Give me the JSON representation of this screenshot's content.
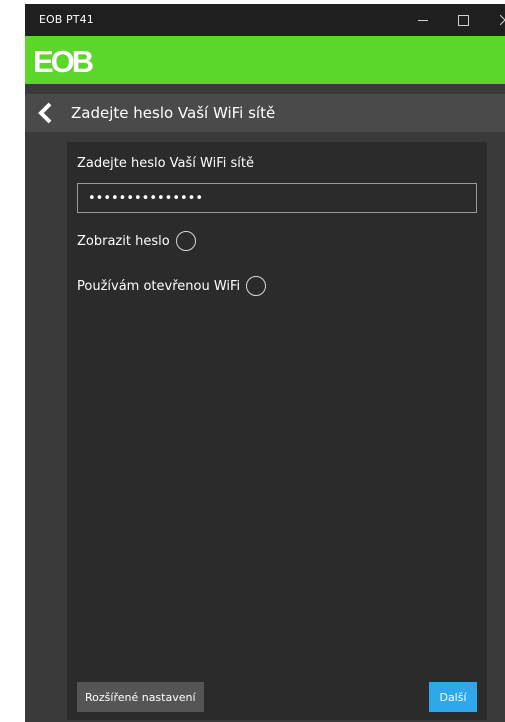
{
  "window": {
    "title": "EOB PT41",
    "minimize_icon": "minimize-icon",
    "maximize_icon": "maximize-icon",
    "close_icon": "close-icon"
  },
  "header": {
    "logo_text": "EOB",
    "brand_color": "#5bd62b"
  },
  "nav": {
    "back_icon": "chevron-left-icon",
    "title": "Zadejte heslo Vaší WiFi sítě"
  },
  "form": {
    "password_label": "Zadejte heslo Vaší WiFi sítě",
    "password_value": "•••••••••••••••",
    "show_password_label": "Zobrazit heslo",
    "show_password_checked": false,
    "open_wifi_label": "Používám otevřenou WiFi",
    "open_wifi_checked": false
  },
  "footer": {
    "advanced_label": "Rozšířené nastavení",
    "next_label": "Další",
    "next_color": "#2ea8ea"
  }
}
